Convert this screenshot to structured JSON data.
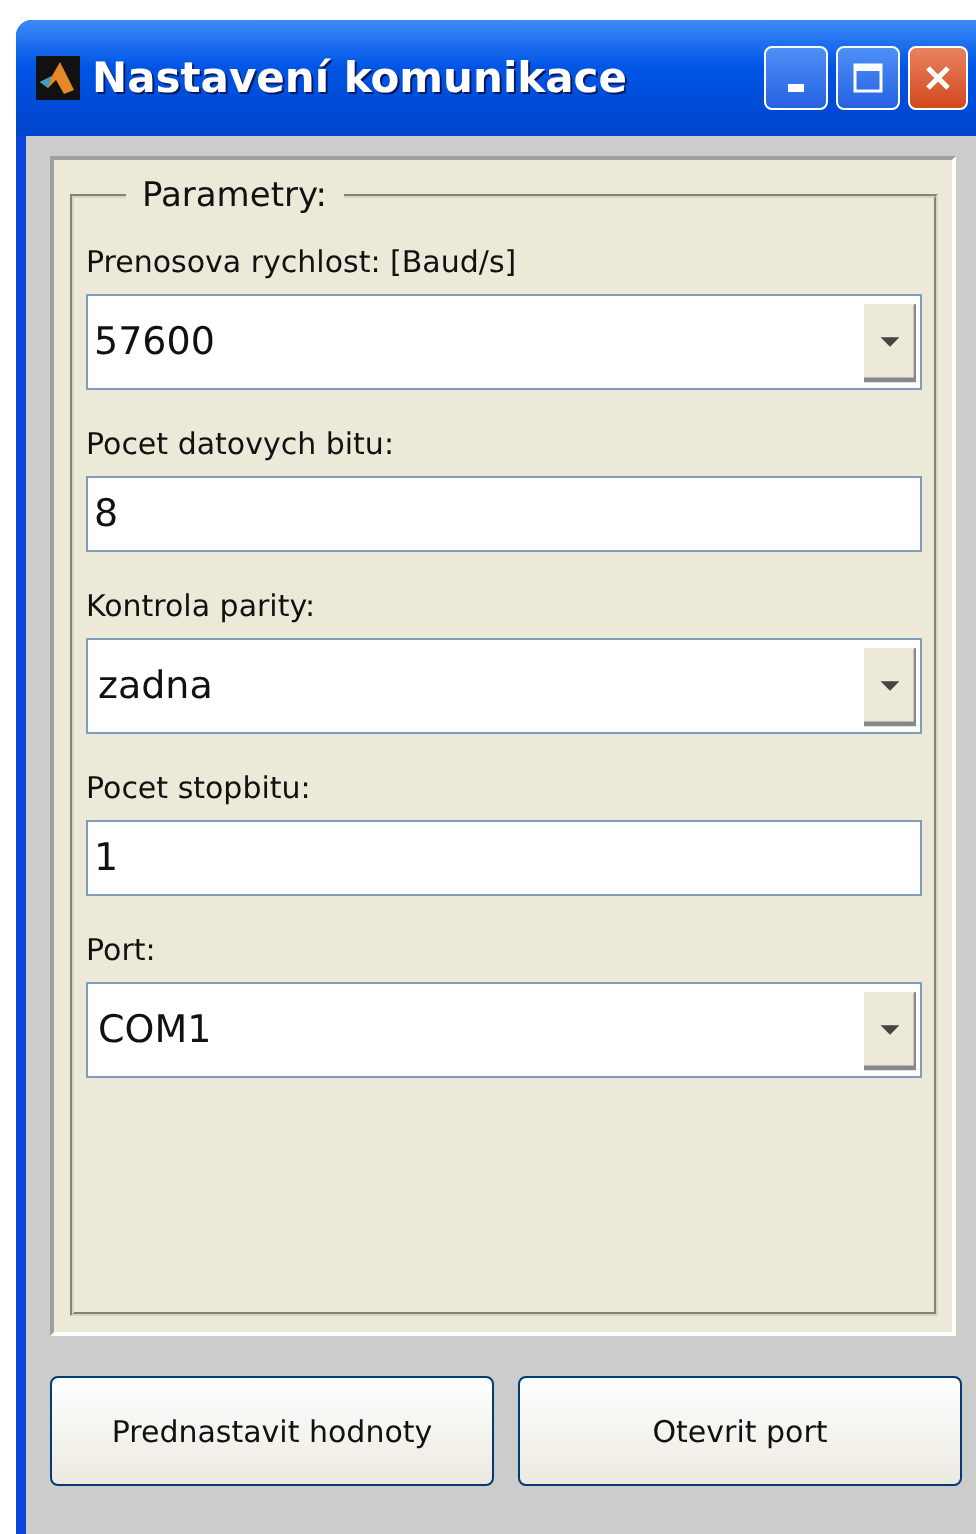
{
  "window": {
    "title": "Nastavení komunikace"
  },
  "group": {
    "title": "Parametry:"
  },
  "fields": [
    {
      "label": "Prenosova rychlost: [Baud/s]",
      "kind": "dropdown",
      "value": "57600"
    },
    {
      "label": "Pocet datovych bitu:",
      "kind": "text",
      "value": "8"
    },
    {
      "label": "Kontrola parity:",
      "kind": "dropdown",
      "value": "zadna"
    },
    {
      "label": "Pocet stopbitu:",
      "kind": "text",
      "value": "1"
    },
    {
      "label": "Port:",
      "kind": "dropdown",
      "value": "COM1"
    }
  ],
  "buttons": [
    "Prednastavit hodnoty",
    "Otevrit port"
  ]
}
